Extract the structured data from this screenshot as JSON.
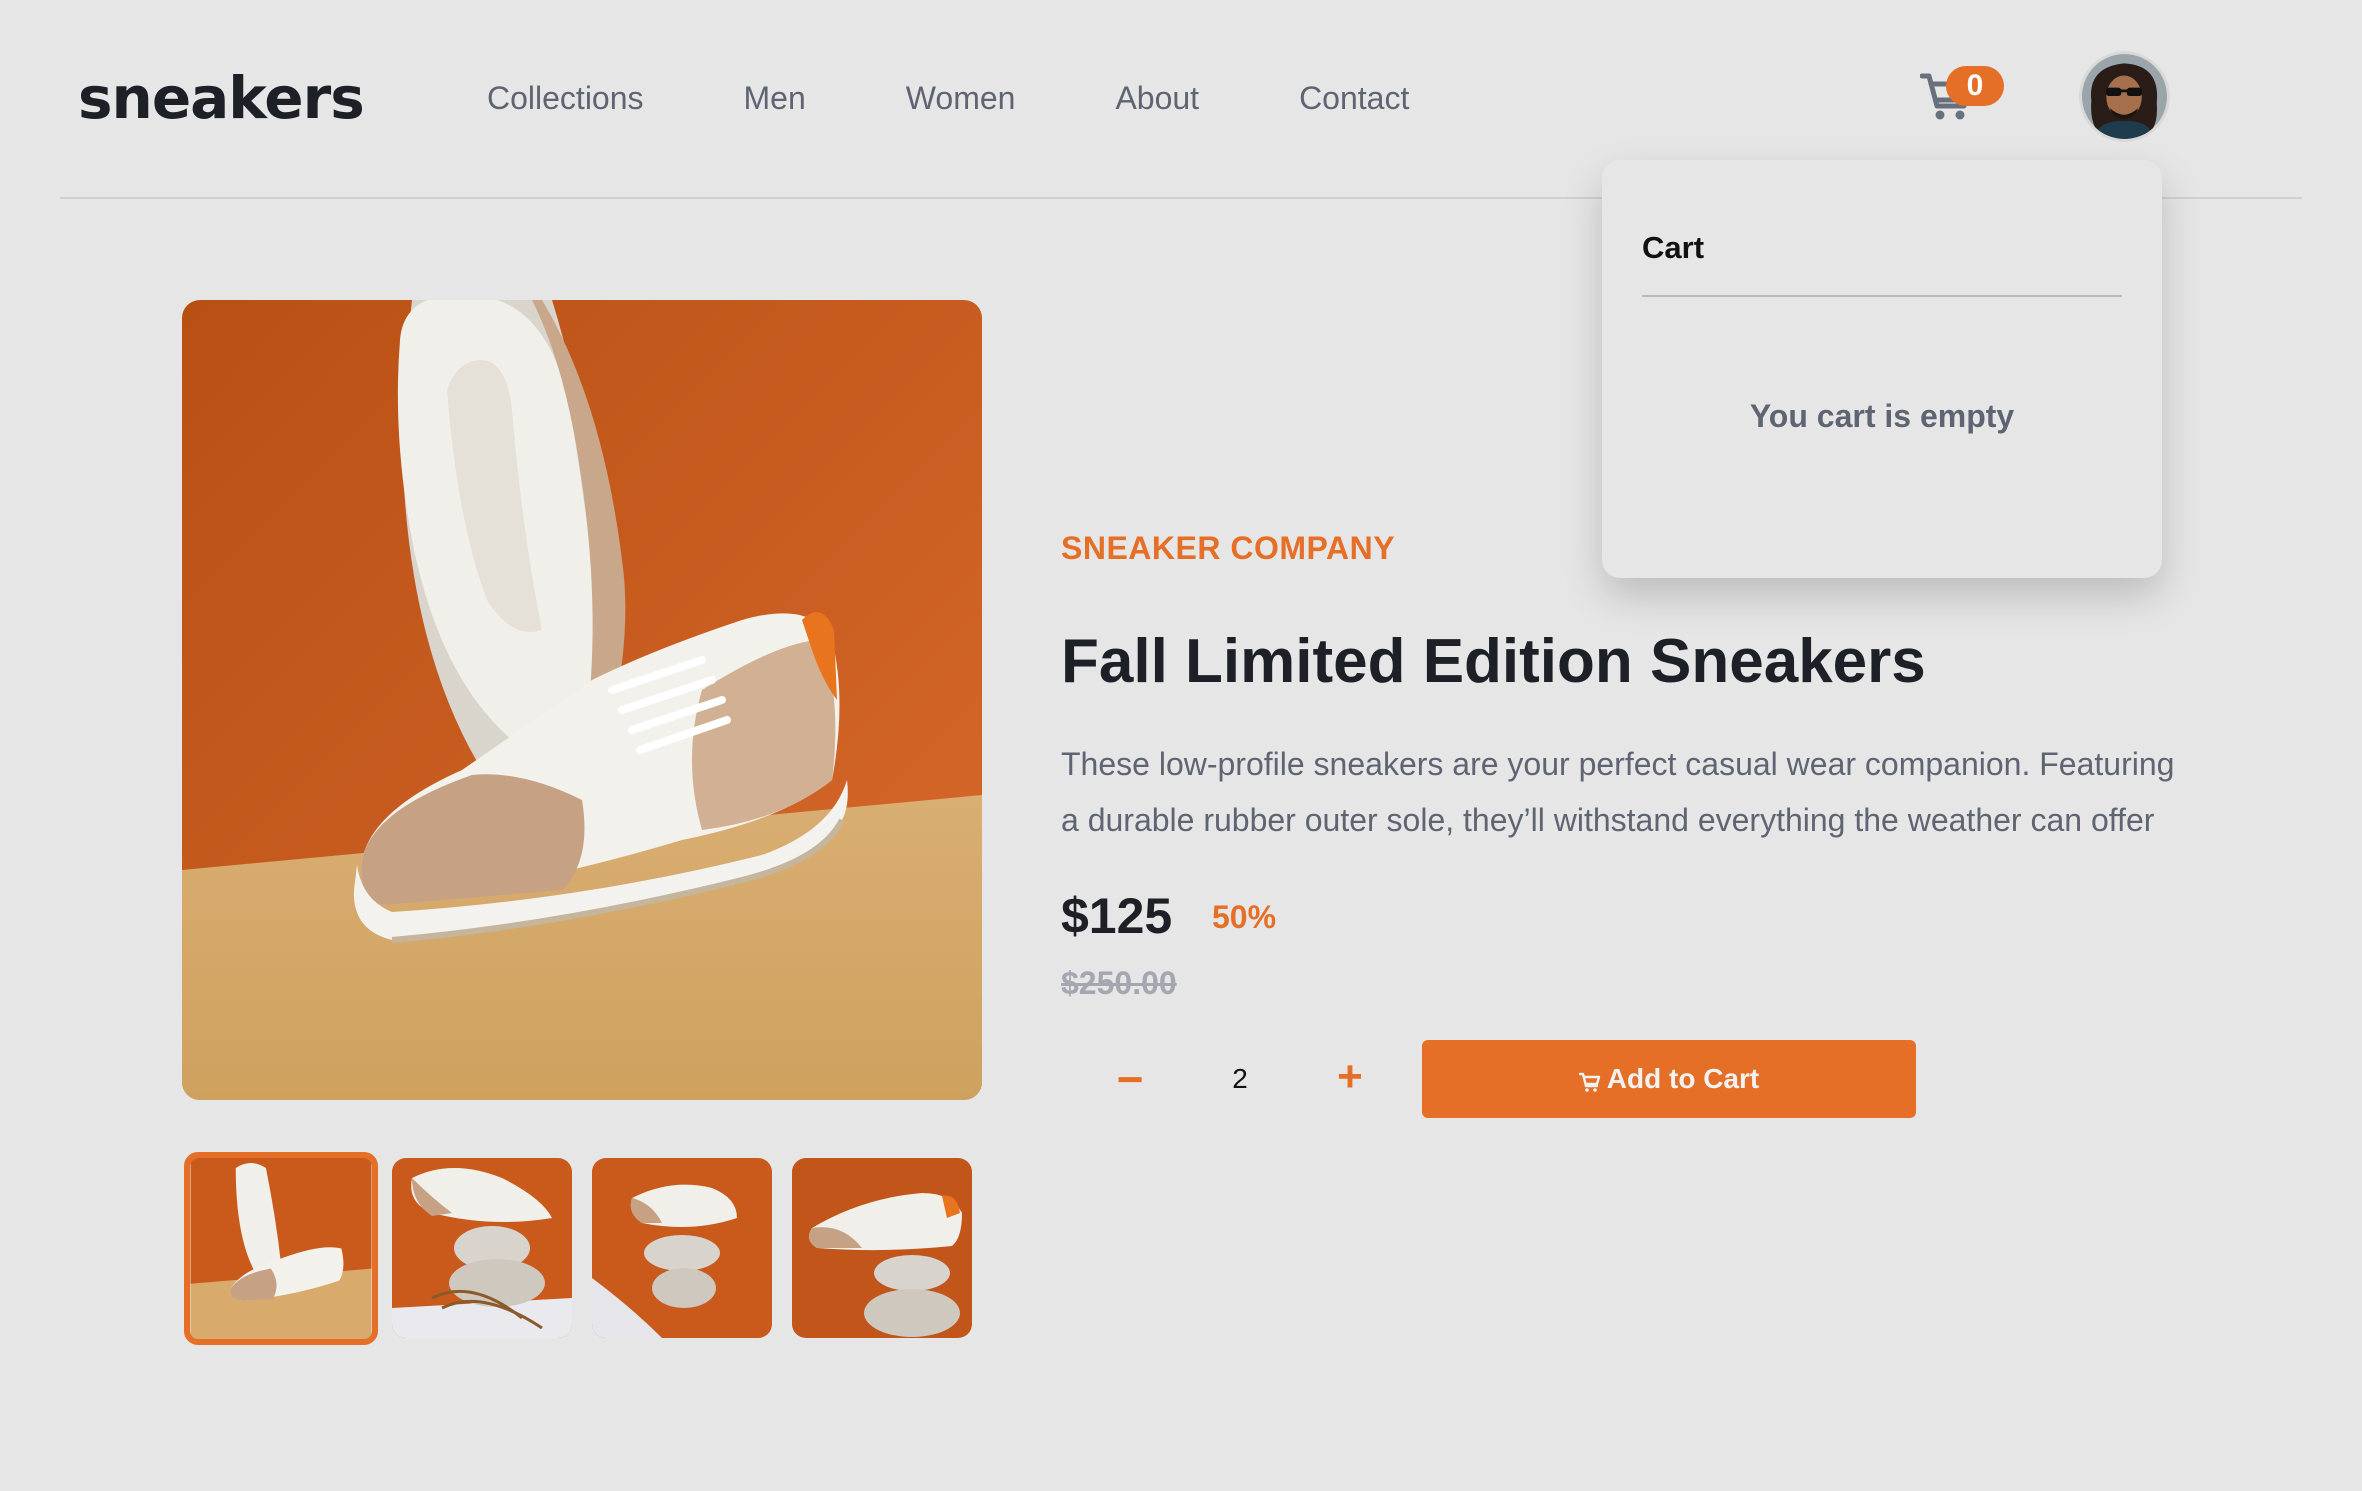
{
  "brand": {
    "logo": "sneakers"
  },
  "nav": {
    "items": [
      "Collections",
      "Men",
      "Women",
      "About",
      "Contact"
    ]
  },
  "header": {
    "cart_count": "0",
    "cart_icon": "cart-icon",
    "avatar": "user-avatar"
  },
  "cart_panel": {
    "title": "Cart",
    "empty_message": "You cart is empty"
  },
  "product": {
    "company": "SNEAKER COMPANY",
    "title": "Fall Limited Edition Sneakers",
    "description": "These low-profile sneakers are your perfect casual wear companion. Featuring a durable rubber outer sole, they’ll withstand everything the weather can offer",
    "price": "$125",
    "discount": "50%",
    "original_price": "$250.00",
    "quantity": "2",
    "minus_label": "−",
    "plus_label": "+",
    "add_to_cart_label": "Add to Cart"
  },
  "gallery": {
    "selected_thumbnail": 1,
    "thumbnail_count": 4
  },
  "colors": {
    "accent": "#e56f27",
    "text_dark": "#1d2026",
    "text_muted": "#5e6472",
    "background": "#e6e6e6"
  }
}
